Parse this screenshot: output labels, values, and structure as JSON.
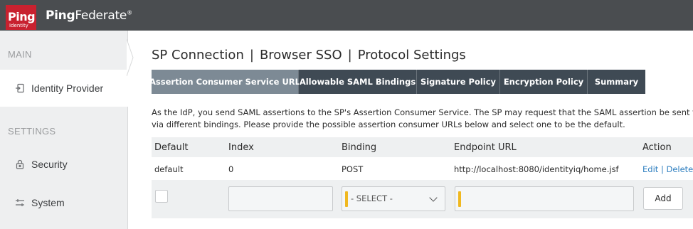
{
  "header": {
    "logo_text": "Ping",
    "logo_subtext": "Identity",
    "product_name_bold": "Ping",
    "product_name_rest": "Federate",
    "product_mark": "®",
    "colors": {
      "bar": "#4a4d50",
      "logo": "#c8212f"
    }
  },
  "sidebar": {
    "section_main": "MAIN",
    "section_settings": "SETTINGS",
    "items": [
      {
        "label": "Identity Provider",
        "icon": "identity-provider-icon",
        "active": true
      },
      {
        "label": "Security",
        "icon": "lock-icon",
        "active": false
      },
      {
        "label": "System",
        "icon": "sliders-icon",
        "active": false
      }
    ]
  },
  "breadcrumb": {
    "parts": [
      "SP Connection",
      "Browser SSO",
      "Protocol Settings"
    ],
    "separator": "|"
  },
  "tabs": [
    {
      "label": "Assertion Consumer Service URL",
      "active": true
    },
    {
      "label": "Allowable SAML Bindings",
      "active": false
    },
    {
      "label": "Signature Policy",
      "active": false
    },
    {
      "label": "Encryption Policy",
      "active": false
    },
    {
      "label": "Summary",
      "active": false
    }
  ],
  "description": {
    "line1": "As the IdP, you send SAML assertions to the SP's Assertion Consumer Service. The SP may request that the SAML assertion be sent to one of sever",
    "line2": "via different bindings. Please provide the possible assertion consumer URLs below and select one to be the default."
  },
  "table": {
    "headers": [
      "Default",
      "Index",
      "Binding",
      "Endpoint URL",
      "Action"
    ],
    "rows": [
      {
        "default": "default",
        "index": "0",
        "binding": "POST",
        "endpoint": "http://localhost:8080/identityiq/home.jsf",
        "edit": "Edit",
        "action_sep": "|",
        "delete": "Delete"
      }
    ],
    "new_row": {
      "index_value": "",
      "binding_selected": "- SELECT -",
      "endpoint_value": "",
      "add_label": "Add"
    }
  }
}
